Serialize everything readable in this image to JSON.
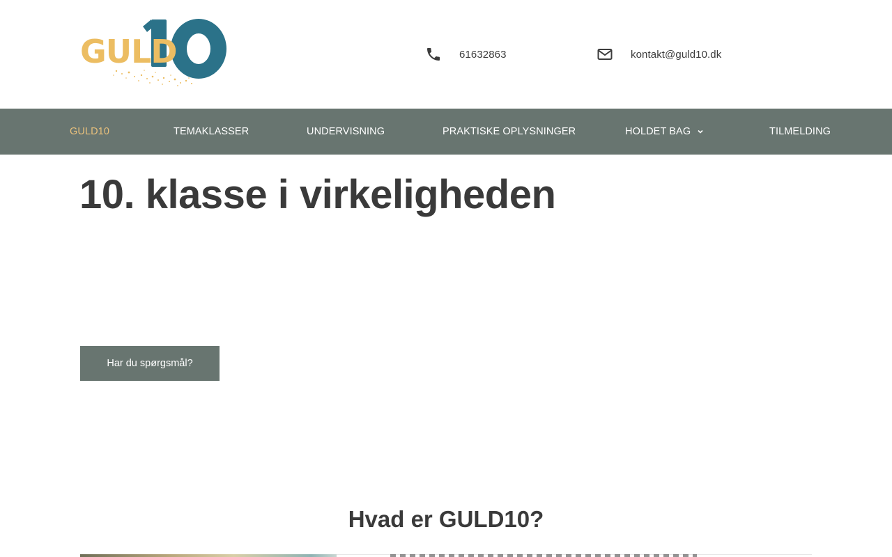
{
  "brand": {
    "logo_text_gold": "GULD",
    "logo_text_blue": "10",
    "colors": {
      "gold": "#ecbd62",
      "blue": "#2b7289",
      "nav_bg": "#687570",
      "active": "#e8c07c"
    }
  },
  "contact": {
    "phone": {
      "icon": "phone-icon",
      "value": "61632863"
    },
    "email": {
      "icon": "mail-icon",
      "value": "kontakt@guld10.dk"
    }
  },
  "nav": {
    "items": [
      {
        "label": "GULD10",
        "active": true
      },
      {
        "label": "TEMAKLASSER"
      },
      {
        "label": "UNDERVISNING"
      },
      {
        "label": "PRAKTISKE OPLYSNINGER"
      },
      {
        "label": "HOLDET BAG",
        "dropdown": true
      },
      {
        "label": "TILMELDING"
      }
    ]
  },
  "hero": {
    "title": "10. klasse i virkeligheden",
    "cta_label": "Har du spørgsmål?"
  },
  "section": {
    "title": "Hvad er GULD10?"
  }
}
